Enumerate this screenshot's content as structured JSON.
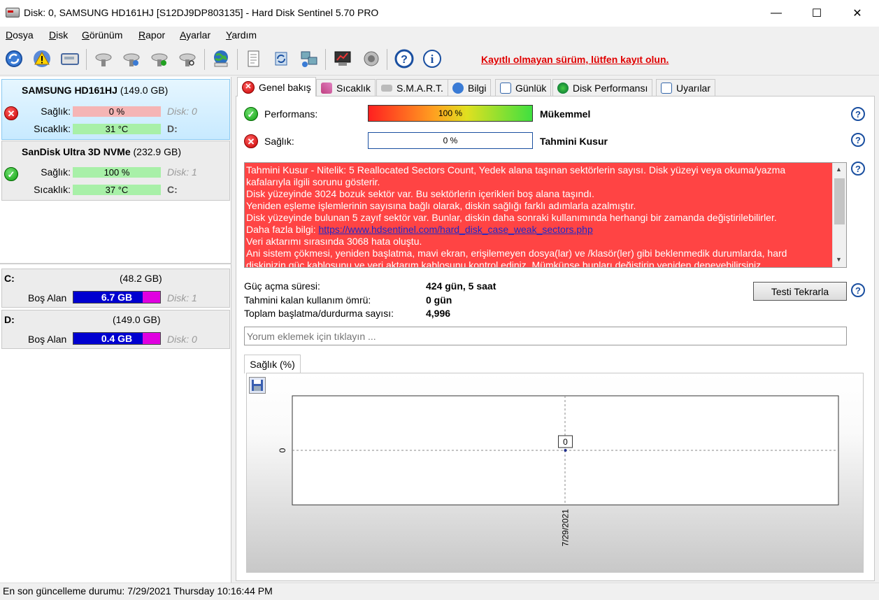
{
  "window": {
    "title": "Disk: 0, SAMSUNG HD161HJ [S12DJ9DP803135]  -  Hard Disk Sentinel 5.70 PRO",
    "controls": {
      "minimize": "—",
      "maximize": "☐",
      "close": "✕"
    }
  },
  "menu": [
    {
      "label": "Dosya",
      "u": "D",
      "rest": "osya"
    },
    {
      "label": "Disk",
      "u": "D",
      "rest": "isk"
    },
    {
      "label": "Görünüm",
      "u": "G",
      "rest": "örünüm"
    },
    {
      "label": "Rapor",
      "u": "R",
      "rest": "apor"
    },
    {
      "label": "Ayarlar",
      "u": "A",
      "rest": "yarlar"
    },
    {
      "label": "Yardım",
      "u": "Y",
      "rest": "ardım"
    }
  ],
  "toolbar": {
    "register_link": "Kayıtlı olmayan sürüm, lütfen kayıt olun.",
    "icons": [
      "refresh-icon",
      "warning-icon",
      "disk-icon",
      "disk-settings-icon",
      "disk-add-icon",
      "disk-check-icon",
      "disk-search-icon",
      "web-update-icon",
      "report-icon",
      "report-send-icon",
      "network-icon",
      "test-icon",
      "sound-icon",
      "help-icon",
      "info-icon"
    ]
  },
  "disks": [
    {
      "name": "SAMSUNG HD161HJ",
      "size": "(149.0 GB)",
      "health_label": "Sağlık:",
      "health": "0 %",
      "health_pct": 0,
      "temp_label": "Sıcaklık:",
      "temp": "31 °C",
      "disk_index": "Disk: 0",
      "drive": "D:",
      "status": "error"
    },
    {
      "name": "SanDisk Ultra 3D NVMe",
      "size": "(232.9 GB)",
      "health_label": "Sağlık:",
      "health": "100 %",
      "health_pct": 100,
      "temp_label": "Sıcaklık:",
      "temp": "37 °C",
      "disk_index": "Disk: 1",
      "drive": "C:",
      "status": "ok"
    }
  ],
  "volumes": [
    {
      "letter": "C:",
      "size": "(48.2 GB)",
      "free_label": "Boş Alan",
      "free": "6.7 GB",
      "free_fraction": 0.14,
      "disk": "Disk: 1"
    },
    {
      "letter": "D:",
      "size": "(149.0 GB)",
      "free_label": "Boş Alan",
      "free": "0.4 GB",
      "free_fraction": 0.003,
      "disk": "Disk: 0"
    }
  ],
  "tabs": [
    "Genel bakış",
    "Sıcaklık",
    "S.M.A.R.T.",
    "Bilgi",
    "Günlük",
    "Disk Performansı",
    "Uyarılar"
  ],
  "overview": {
    "performance_label": "Performans:",
    "performance_value": "100 %",
    "performance_pct": 100,
    "performance_text": "Mükemmel",
    "health_label": "Sağlık:",
    "health_value": "0 %",
    "health_pct": 0,
    "health_text": "Tahmini Kusur",
    "message_lines": [
      "Tahmini Kusur - Nitelik: 5 Reallocated Sectors Count, Yedek alana taşınan sektörlerin sayısı. Disk yüzeyi veya okuma/yazma",
      "kafalarıyla ilgili sorunu gösterir.",
      "Disk yüzeyinde 3024 bozuk sektör var. Bu sektörlerin içerikleri boş alana taşındı.",
      "Yeniden eşleme işlemlerinin sayısına bağlı olarak, diskin sağlığı farklı adımlarla azalmıştır.",
      "Disk yüzeyinde bulunan 5 zayıf sektör var. Bunlar, diskin daha sonraki kullanımında herhangi bir zamanda değiştirilebilirler."
    ],
    "more_info_label": "Daha fazla bilgi: ",
    "more_info_link": "https://www.hdsentinel.com/hard_disk_case_weak_sectors.php",
    "message_lines2": [
      "Veri aktarımı sırasında 3068 hata oluştu.",
      "Ani sistem çökmesi, yeniden başlatma, mavi ekran, erişilemeyen dosya(lar) ve /klasör(ler) gibi beklenmedik durumlarda, hard",
      "diskinizin güç kablosunu ve veri aktarım kablosunu kontrol ediniz. Mümkünse bunları değiştirip yeniden deneyebilirsiniz."
    ],
    "power_on_label": "Güç açma süresi:",
    "power_on_value": "424 gün, 5 saat",
    "remaining_label": "Tahmini kalan kullanım ömrü:",
    "remaining_value": "0 gün",
    "start_stop_label": "Toplam başlatma/durdurma sayısı:",
    "start_stop_value": "4,996",
    "retest_button": "Testi Tekrarla",
    "comment_placeholder": "Yorum eklemek için tıklayın ..."
  },
  "chart_tab": "Sağlık (%)",
  "chart_data": {
    "type": "line",
    "x": [
      "7/29/2021"
    ],
    "y": [
      0
    ],
    "title": "",
    "xlabel": "",
    "ylabel": "",
    "ytick_labels": [
      "0"
    ],
    "data_labels": [
      "0"
    ],
    "grid": true
  },
  "status": {
    "text": "En son güncelleme durumu: 7/29/2021 Thursday 10:16:44 PM"
  }
}
